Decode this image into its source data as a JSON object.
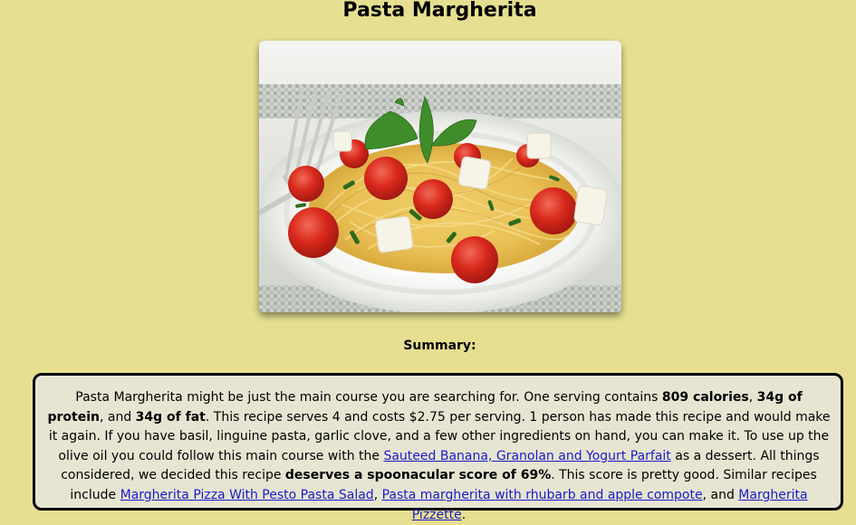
{
  "recipe": {
    "title": "Pasta Margherita",
    "image_alt": "Pasta Margherita"
  },
  "summary": {
    "label": "Summary:",
    "t1": "Pasta Margherita might be just the main course you are searching for. One serving contains ",
    "calories": "809 calories",
    "t2": ", ",
    "protein": "34g of protein",
    "t3": ", and ",
    "fat": "34g of fat",
    "t4": ". This recipe serves 4 and costs $2.75 per serving. 1 person has made this recipe and would make it again. If you have basil, linguine pasta, garlic clove, and a few other ingredients on hand, you can make it. To use up the olive oil you could follow this main course with the ",
    "link_dessert": "Sauteed Banana, Granolan and Yogurt Parfait",
    "t5": " as a dessert. All things considered, we decided this recipe ",
    "score": "deserves a spoonacular score of 69%",
    "t6": ". This score is pretty good. Similar recipes include ",
    "link_similar_1": "Margherita Pizza With Pesto Pasta Salad",
    "t7": ", ",
    "link_similar_2": "Pasta margherita with rhubarb and apple compote",
    "t8": ", and ",
    "link_similar_3": "Margherita Pizzette",
    "t9": "."
  },
  "colors": {
    "page_background": "#e6df91",
    "summary_background": "#e6e5d2",
    "link": "#1a1acc"
  }
}
